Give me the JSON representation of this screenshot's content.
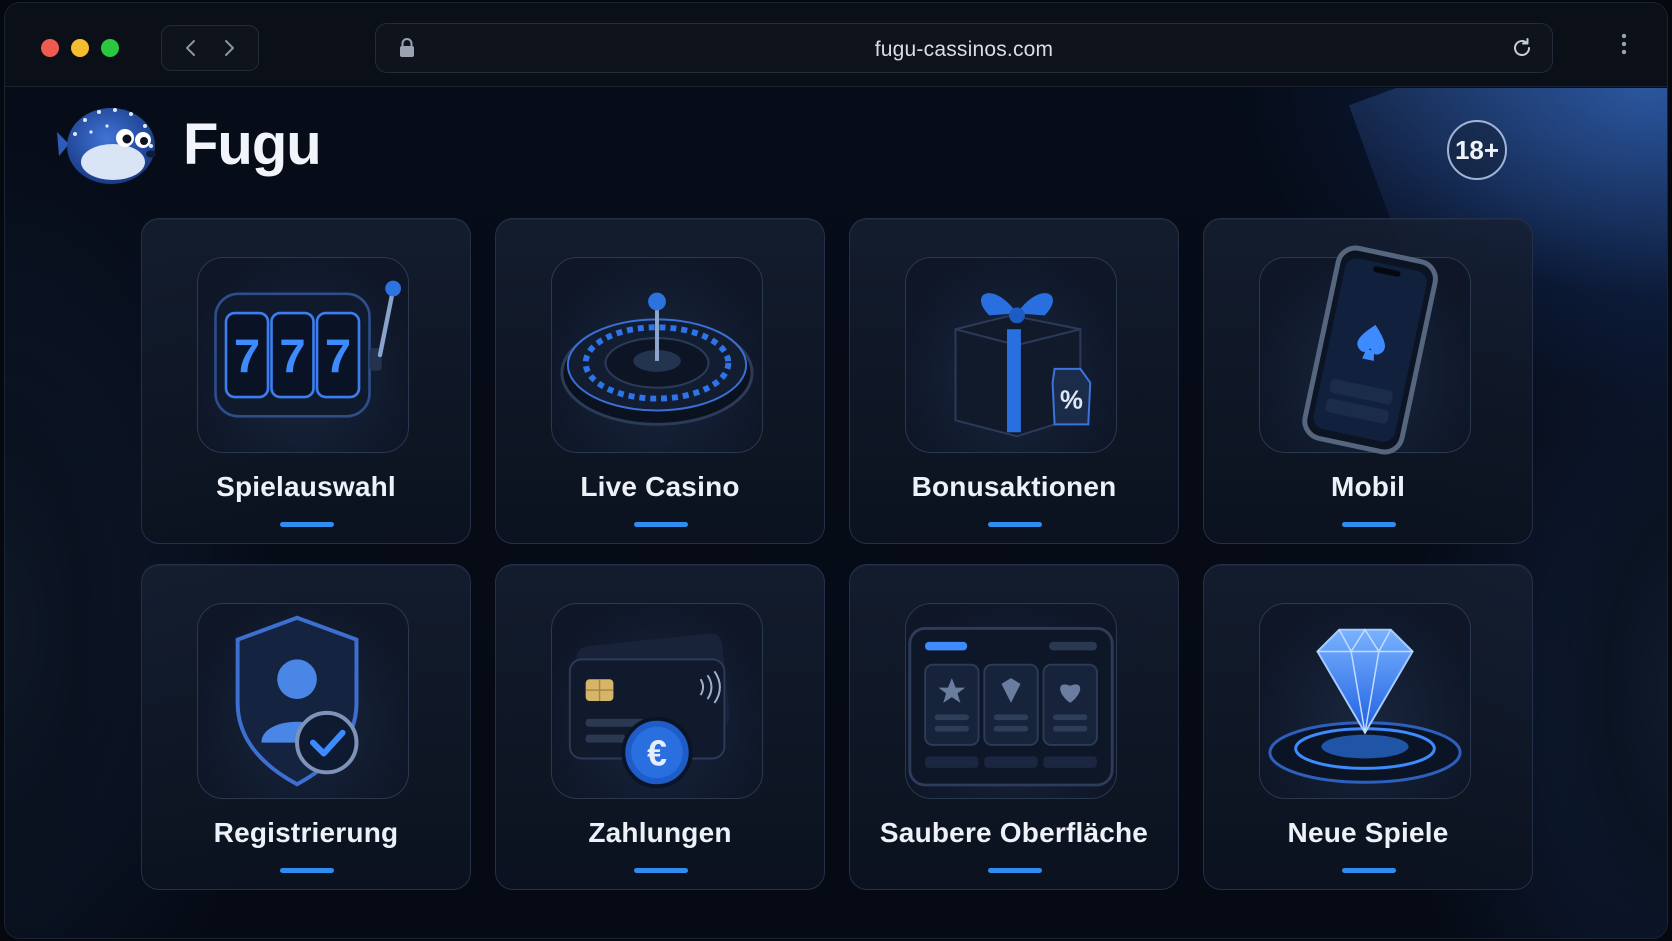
{
  "browser": {
    "url": "fugu-cassinos.com"
  },
  "header": {
    "brand": "Fugu",
    "age_badge": "18+"
  },
  "cards": [
    {
      "label": "Spielauswahl",
      "icon": "slot-machine-icon"
    },
    {
      "label": "Live Casino",
      "icon": "roulette-wheel-icon"
    },
    {
      "label": "Bonusaktionen",
      "icon": "gift-box-icon"
    },
    {
      "label": "Mobil",
      "icon": "smartphone-icon"
    },
    {
      "label": "Registrierung",
      "icon": "shield-user-icon"
    },
    {
      "label": "Zahlungen",
      "icon": "payment-card-euro-icon"
    },
    {
      "label": "Saubere Oberfläche",
      "icon": "interface-layout-icon"
    },
    {
      "label": "Neue Spiele",
      "icon": "diamond-icon"
    }
  ],
  "slot_symbols": [
    "7",
    "7",
    "7"
  ],
  "gift_tag": "%",
  "coin_symbol": "€",
  "colors": {
    "accent": "#2f8cf0",
    "background": "#060b15",
    "card_border": "#233047"
  }
}
